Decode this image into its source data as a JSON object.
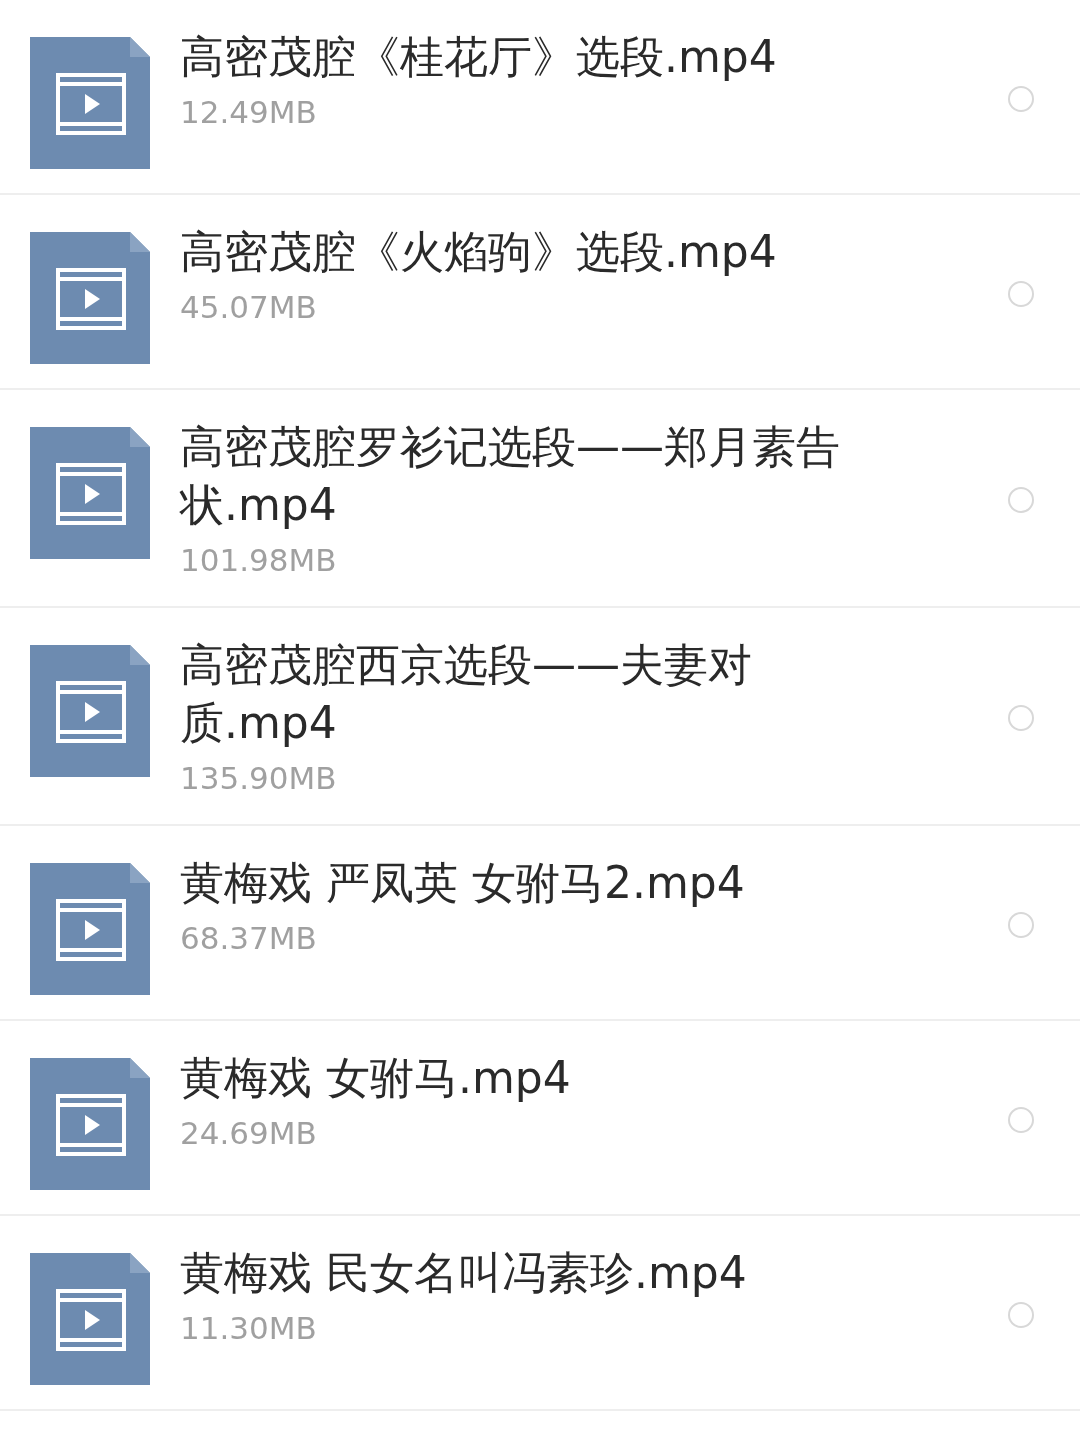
{
  "files": [
    {
      "title_lines": [
        "高密茂腔《桂花厅》选段.mp4"
      ],
      "size": "12.49MB",
      "selected": false
    },
    {
      "title_lines": [
        "高密茂腔《火焰驹》选段.mp4"
      ],
      "size": "45.07MB",
      "selected": false
    },
    {
      "title_lines": [
        "高密茂腔罗衫记选段——郑月素告",
        "状.mp4"
      ],
      "size": "101.98MB",
      "selected": false
    },
    {
      "title_lines": [
        "高密茂腔西京选段——夫妻对",
        "质.mp4"
      ],
      "size": "135.90MB",
      "selected": false
    },
    {
      "title_lines": [
        "黄梅戏 严凤英 女驸马2.mp4"
      ],
      "size": "68.37MB",
      "selected": false
    },
    {
      "title_lines": [
        "黄梅戏 女驸马.mp4"
      ],
      "size": "24.69MB",
      "selected": false
    },
    {
      "title_lines": [
        "黄梅戏 民女名叫冯素珍.mp4"
      ],
      "size": "11.30MB",
      "selected": false
    }
  ]
}
